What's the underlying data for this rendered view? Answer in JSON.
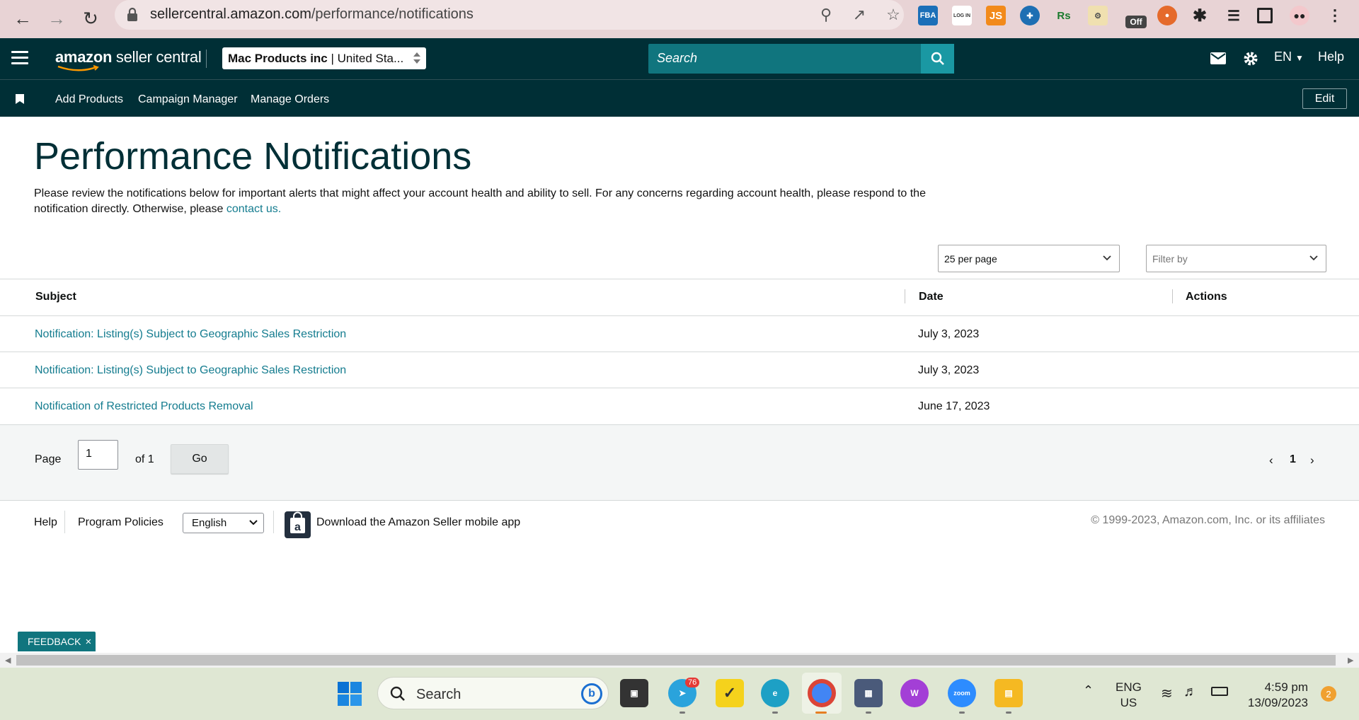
{
  "browser": {
    "url_host": "sellercentral.amazon.com",
    "url_path": "/performance/notifications",
    "extensions": [
      "FBA",
      "LOG IN",
      "JS",
      "Rs",
      "Off"
    ]
  },
  "header": {
    "logo_bold": "amazon",
    "logo_rest": " seller central",
    "account_name": "Mac Products inc",
    "account_region": " | United Sta...",
    "search_placeholder": "Search",
    "language": "EN",
    "help": "Help"
  },
  "subnav": {
    "links": [
      "Add Products",
      "Campaign Manager",
      "Manage Orders"
    ],
    "edit": "Edit"
  },
  "main": {
    "title": "Performance Notifications",
    "description": "Please review the notifications below for important alerts that might affect your account health and ability to sell. For any concerns regarding account health, please respond to the notification directly. Otherwise, please ",
    "contact_link": "contact us.",
    "per_page": "25 per page",
    "filter_placeholder": "Filter by"
  },
  "table": {
    "headers": {
      "subject": "Subject",
      "date": "Date",
      "actions": "Actions"
    },
    "rows": [
      {
        "subject": "Notification: Listing(s) Subject to Geographic Sales Restriction",
        "date": "July 3, 2023"
      },
      {
        "subject": "Notification: Listing(s) Subject to Geographic Sales Restriction",
        "date": "July 3, 2023"
      },
      {
        "subject": "Notification of Restricted Products Removal",
        "date": "June 17, 2023"
      }
    ]
  },
  "pagination": {
    "page_label": "Page",
    "page_value": "1",
    "of_label": "of 1",
    "go": "Go",
    "current": "1"
  },
  "footer": {
    "help": "Help",
    "policies": "Program Policies",
    "language": "English",
    "download": "Download the Amazon Seller mobile app",
    "copyright": "© 1999-2023, Amazon.com, Inc. or its affiliates"
  },
  "feedback": {
    "label": "FEEDBACK",
    "close": "×"
  },
  "taskbar": {
    "search": "Search",
    "telegram_badge": "76",
    "lang_1": "ENG",
    "lang_2": "US",
    "time": "4:59 pm",
    "date": "13/09/2023",
    "notifications": "2",
    "zoom_label": "zoom"
  },
  "colors": {
    "header_bg": "#002f36",
    "link": "#147c8f",
    "search_bg": "#10757e",
    "feedback_bg": "#10757e"
  }
}
